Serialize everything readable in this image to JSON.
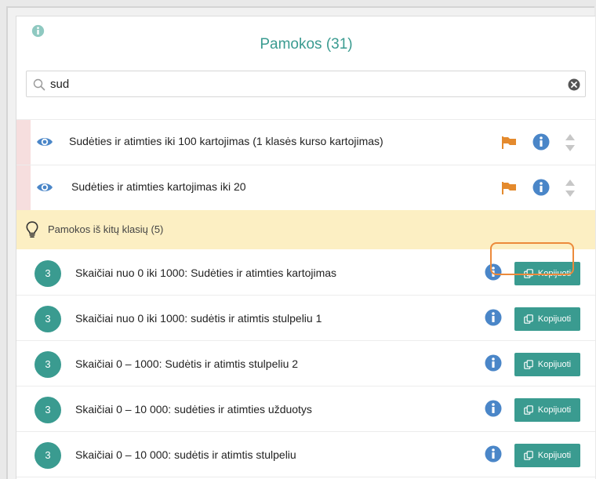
{
  "header": {
    "title": "Pamokos (31)",
    "info_icon": "info-circle-icon"
  },
  "search": {
    "value": "sud",
    "icon": "search-icon",
    "clear_icon": "clear-x-icon"
  },
  "lessons": [
    {
      "label": "Sudėties ir atimties iki 100 kartojimas (1 klasės kurso kartojimas)"
    },
    {
      "label": "Sudėties ir atimties kartojimas iki 20"
    }
  ],
  "other_section": {
    "label": "Pamokos iš kitų klasių (5)",
    "icon": "lightbulb-icon"
  },
  "other_lessons": [
    {
      "grade": "3",
      "label": "Skaičiai nuo 0 iki 1000: Sudėties ir atimties kartojimas",
      "button": "Kopijuoti"
    },
    {
      "grade": "3",
      "label": "Skaičiai nuo 0 iki 1000: sudėtis ir atimtis stulpeliu 1",
      "button": "Kopijuoti"
    },
    {
      "grade": "3",
      "label": "Skaičiai 0 – 1000: Sudėtis ir atimtis stulpeliu 2",
      "button": "Kopijuoti"
    },
    {
      "grade": "3",
      "label": "Skaičiai 0 – 10 000: sudėties ir atimties užduotys",
      "button": "Kopijuoti"
    },
    {
      "grade": "3",
      "label": "Skaičiai 0 – 10 000: sudėtis ir atimtis stulpeliu",
      "button": "Kopijuoti"
    }
  ],
  "colors": {
    "accent": "#3a9b90",
    "info_blue": "#4a86c8",
    "flag_orange": "#e48a2d",
    "section_bg": "#fcefc3",
    "highlight": "#ec8a3b"
  }
}
